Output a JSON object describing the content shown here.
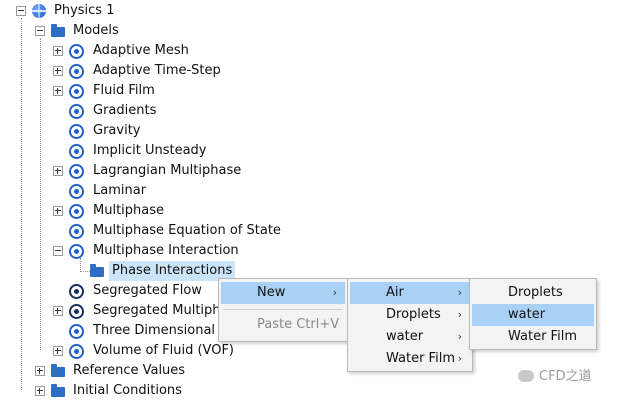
{
  "tree": {
    "root": "Physics 1",
    "models_folder": "Models",
    "models": [
      "Adaptive Mesh",
      "Adaptive Time-Step",
      "Fluid Film",
      "Gradients",
      "Gravity",
      "Implicit Unsteady",
      "Lagrangian Multiphase",
      "Laminar",
      "Multiphase",
      "Multiphase Equation of State",
      "Multiphase Interaction",
      "Segregated Flow",
      "Segregated Multipha",
      "Three Dimensional",
      "Volume of Fluid (VOF)"
    ],
    "phase_interactions": "Phase Interactions",
    "reference_values": "Reference Values",
    "initial_conditions": "Initial Conditions"
  },
  "context_menu": {
    "new": "New",
    "paste": "Paste Ctrl+V"
  },
  "submenu_new": [
    "Air",
    "Droplets",
    "water",
    "Water Film"
  ],
  "submenu_air": [
    "Droplets",
    "water",
    "Water Film"
  ],
  "watermark": "CFD之道",
  "colors": {
    "highlight": "#a9d1f5",
    "selection": "#cce4f7",
    "icon_blue": "#1f5fc8"
  }
}
